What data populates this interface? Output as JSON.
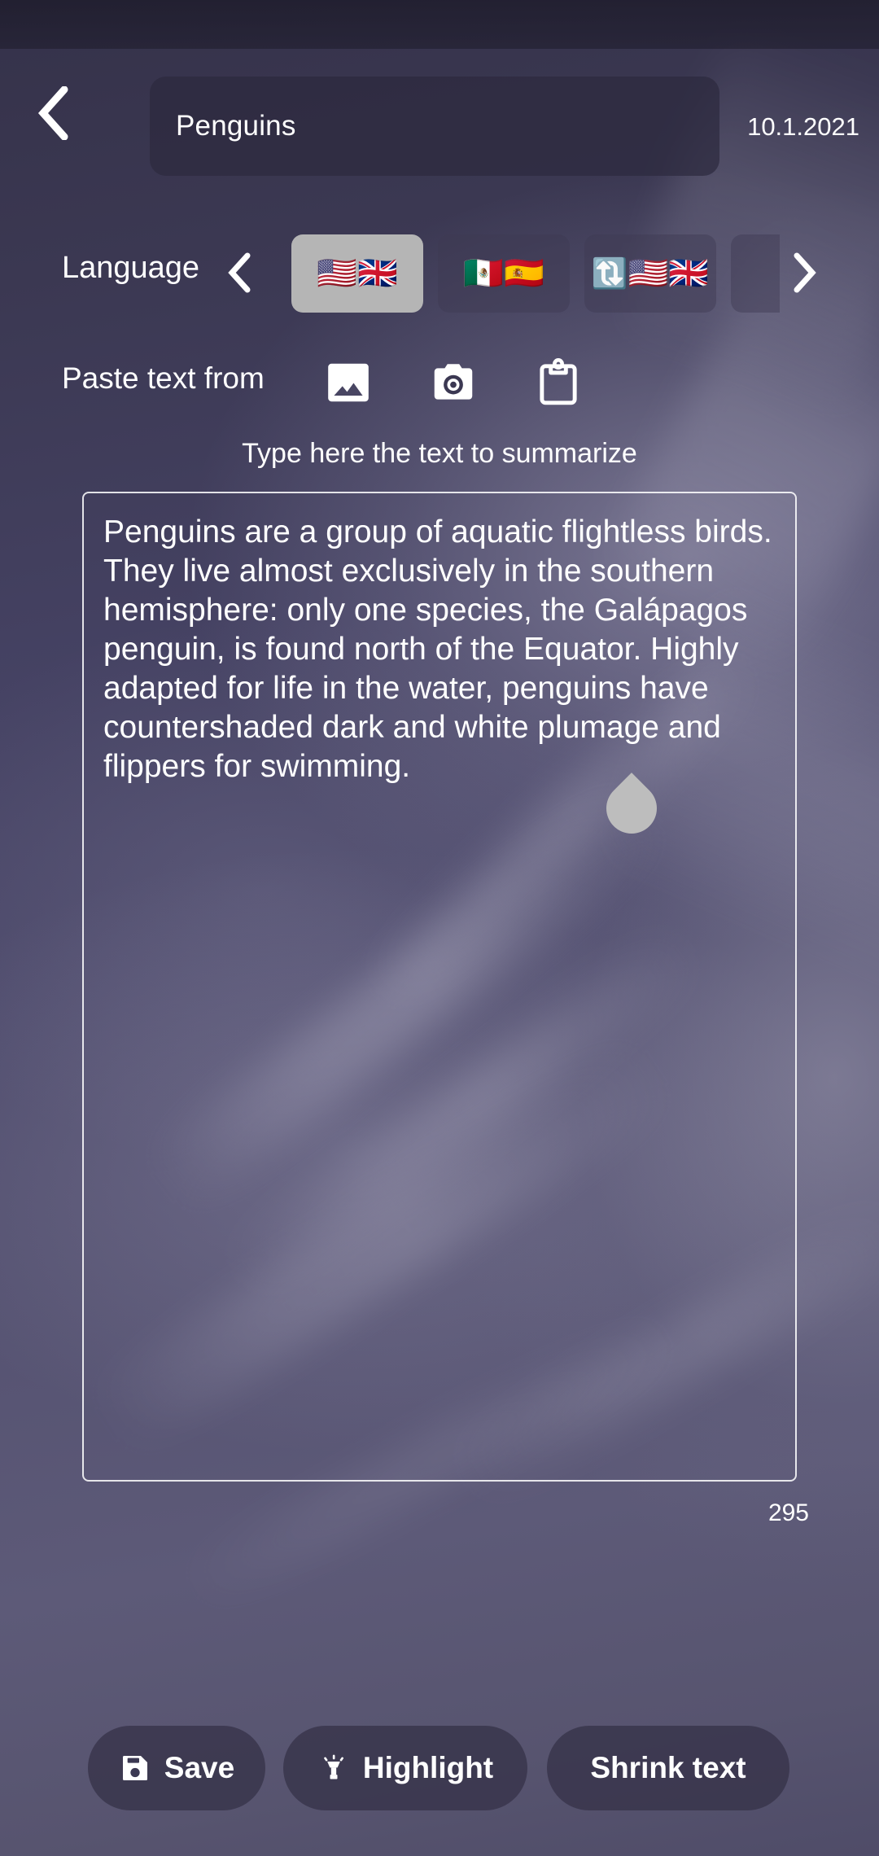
{
  "app": {
    "background_color": "#4d4a6b"
  },
  "header": {
    "back_icon": "chevron-left-icon",
    "title_value": "Penguins",
    "title_placeholder": "Title",
    "date": "10.1.2021"
  },
  "language": {
    "label": "Language",
    "prev_icon": "chevron-left-icon",
    "next_icon": "chevron-right-icon",
    "options": [
      {
        "id": "en-us-uk",
        "flags": [
          "🇺🇸",
          "🇬🇧"
        ],
        "selected": true
      },
      {
        "id": "mx-es",
        "flags": [
          "🇲🇽",
          "🇪🇸"
        ],
        "selected": false
      },
      {
        "id": "auto-en",
        "flags": [
          "🔄",
          "🇺🇸",
          "🇬🇧"
        ],
        "selected": false
      },
      {
        "id": "next-partial",
        "flags": [],
        "selected": false
      }
    ]
  },
  "paste": {
    "label": "Paste text from",
    "buttons": [
      {
        "id": "image",
        "icon": "image-icon"
      },
      {
        "id": "camera",
        "icon": "camera-icon"
      },
      {
        "id": "clipboard",
        "icon": "clipboard-icon"
      }
    ]
  },
  "editor": {
    "prompt": "Type here the text to summarize",
    "value": "Penguins are a group of aquatic flightless birds. They live almost exclusively in the southern hemisphere: only one species, the Galápagos penguin, is found north of the Equator. Highly adapted for life in the water, penguins have countershaded dark and white plumage and flippers for swimming.",
    "char_count": "295",
    "handle_icon": "text-selection-handle"
  },
  "actions": {
    "save": {
      "label": "Save",
      "icon": "floppy-disk-icon"
    },
    "highlight": {
      "label": "Highlight",
      "icon": "highlighter-icon"
    },
    "shrink": {
      "label": "Shrink text"
    }
  }
}
